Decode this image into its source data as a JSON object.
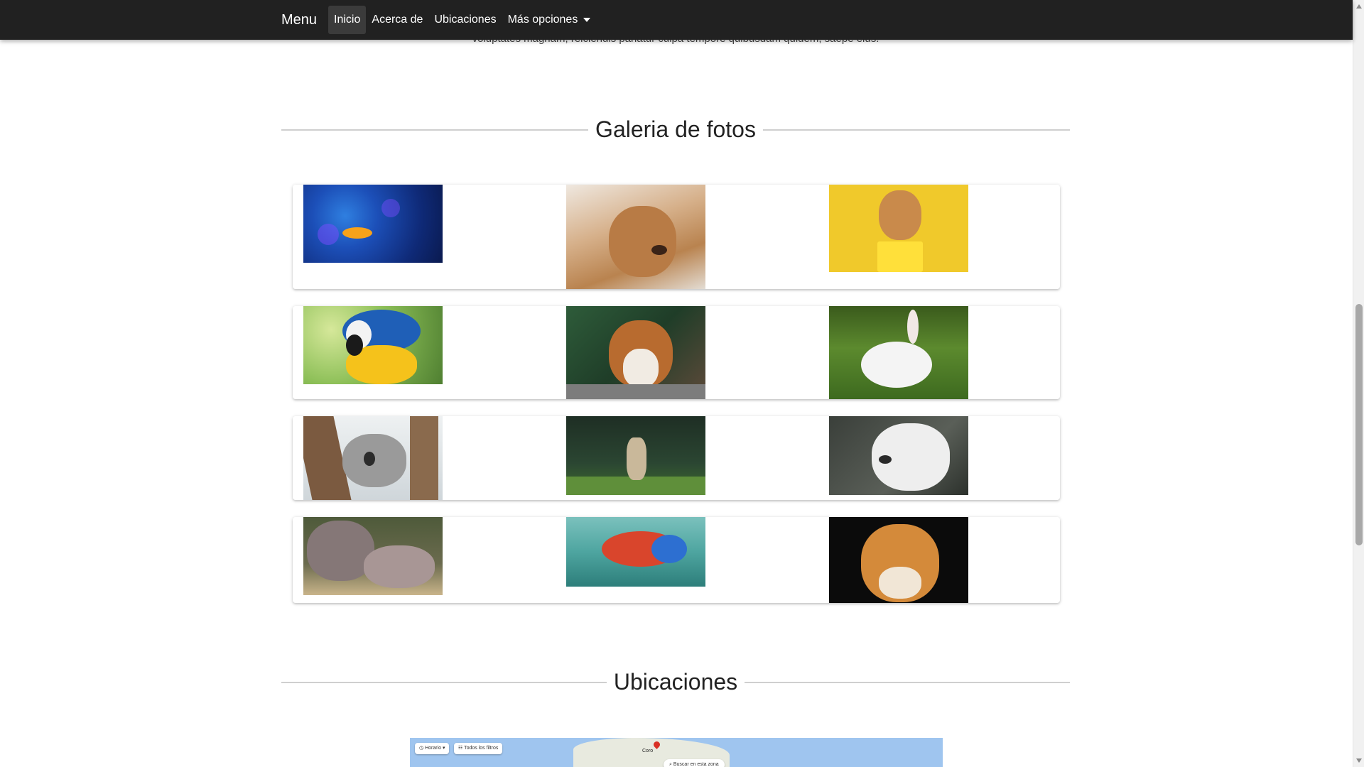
{
  "nav": {
    "brand": "Menu",
    "items": [
      {
        "label": "Inicio"
      },
      {
        "label": "Acerca de"
      },
      {
        "label": "Ubicaciones"
      },
      {
        "label": "Más opciones"
      }
    ]
  },
  "intro": {
    "clipped_text": "voluptates magnam, reiciendis pariatur culpa tempore quibusdam quidem, saepe eius."
  },
  "gallery": {
    "title": "Galeria de fotos",
    "photos": [
      {
        "subject": "fish",
        "alt": "Pez naranja"
      },
      {
        "subject": "dog",
        "alt": "Perro golden"
      },
      {
        "subject": "kitten",
        "alt": "Gatito en cubo amarillo"
      },
      {
        "subject": "parrot",
        "alt": "Guacamayo"
      },
      {
        "subject": "squirrel",
        "alt": "Ardilla"
      },
      {
        "subject": "rabbit",
        "alt": "Conejo blanco"
      },
      {
        "subject": "koala",
        "alt": "Koala"
      },
      {
        "subject": "deer",
        "alt": "Ciervo"
      },
      {
        "subject": "wolf",
        "alt": "Lobo blanco"
      },
      {
        "subject": "hippo",
        "alt": "Hipopótamos"
      },
      {
        "subject": "chameleon",
        "alt": "Camaleón"
      },
      {
        "subject": "tiger",
        "alt": "Tigre"
      }
    ]
  },
  "locations": {
    "title": "Ubicaciones",
    "map": {
      "chip_hours": "Horario",
      "chip_filters": "Todos los filtros",
      "search_area": "Buscar en esta zona",
      "place_label": "Coro"
    }
  },
  "colors": {
    "navbar": "#212121",
    "active_nav": "#3b3b3b",
    "map_water": "#9fc5ef",
    "map_land": "#e8eadf"
  }
}
